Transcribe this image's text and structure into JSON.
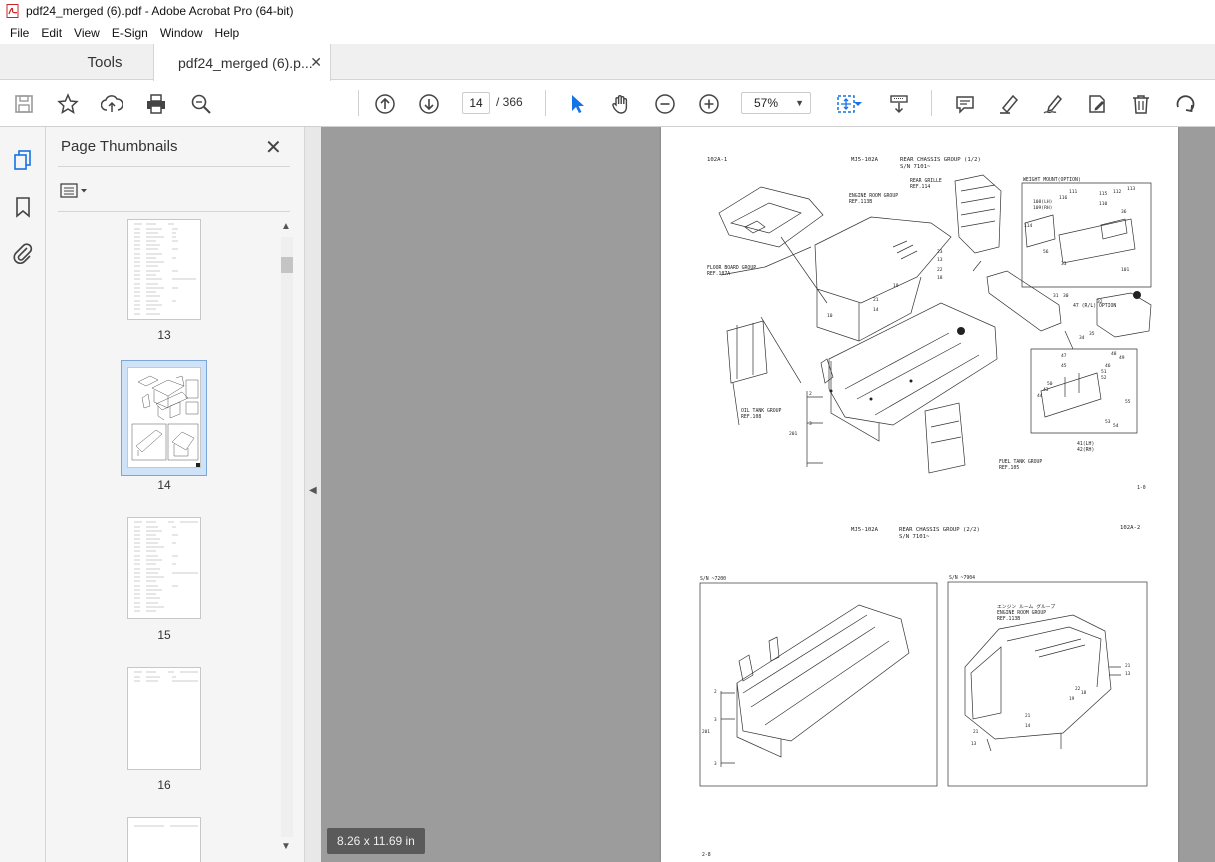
{
  "window": {
    "title": "pdf24_merged (6).pdf - Adobe Acrobat Pro (64-bit)"
  },
  "menu": [
    "File",
    "Edit",
    "View",
    "E-Sign",
    "Window",
    "Help"
  ],
  "tabs": {
    "tools": "Tools",
    "document": "pdf24_merged (6).p...",
    "close_glyph": "✕"
  },
  "toolbar": {
    "current_page": "14",
    "total_pages": "/ 366",
    "zoom": "57%",
    "icons": [
      "save-icon",
      "bookmark-star-icon",
      "upload-icon",
      "print-icon",
      "zoom-search-icon",
      "page-up-icon",
      "page-down-icon",
      "select-cursor-icon",
      "hand-icon",
      "zoom-out-icon",
      "zoom-in-icon",
      "fit-page-icon",
      "scroll-mode-icon",
      "comment-icon",
      "highlight-icon",
      "sign-icon",
      "edit-icon",
      "delete-icon",
      "rotate-icon"
    ]
  },
  "side_panel": {
    "title": "Page Thumbnails",
    "close_glyph": "✕",
    "thumbnails": [
      {
        "label": "13",
        "kind": "list"
      },
      {
        "label": "14",
        "kind": "drawing",
        "selected": true
      },
      {
        "label": "15",
        "kind": "list"
      },
      {
        "label": "16",
        "kind": "short-list"
      }
    ]
  },
  "page_size_label": "8.26 x 11.69 in",
  "document_page": {
    "header_left": "102A-1",
    "header_code": "MJ5-102A",
    "header_title": "REAR CHASSIS GROUP (1/2)",
    "header_sn": "S/N 7101~",
    "labels": {
      "engine_room": "ENGINE ROOM GROUP",
      "engine_room_ref": "REF.113B",
      "rear_grille": "REAR GRILLE",
      "rear_grille_ref": "REF.114",
      "weight_mount": "WEIGHT MOUNT(OPTION)",
      "floor_board": "FLOOR BOARD GROUP",
      "floor_board_ref": "REF.107A",
      "oil_tank": "OIL TANK GROUP",
      "oil_tank_ref": "REF.108",
      "fuel_tank": "FUEL TANK GROUP",
      "fuel_tank_ref": "REF.105",
      "option": "47 (R/L) OPTION",
      "part_41": "41(LH)",
      "part_42": "42(RH)",
      "corner_mark": "1-0"
    },
    "section2_code": "MJ5-102A",
    "section2_title": "REAR CHASSIS GROUP (2/2)",
    "section2_sn": "S/N 7101~",
    "section2_right": "102A-2",
    "box1_label": "S/N ~7200",
    "box2_label": "S/N ~7904",
    "box2_jp": "エンジン ルーム グループ",
    "box2_title": "ENGINE ROOM GROUP",
    "box2_ref": "REF.113B",
    "footer": "2-8",
    "callouts": [
      "111",
      "115",
      "112",
      "113",
      "108(LH)",
      "109(RH)",
      "116",
      "110",
      "114",
      "101",
      "23",
      "13",
      "22",
      "18",
      "19",
      "21",
      "14",
      "10",
      "2",
      "3",
      "201",
      "31",
      "30",
      "32",
      "33",
      "34",
      "35",
      "36",
      "47",
      "45",
      "46",
      "48",
      "49",
      "50",
      "43",
      "44",
      "51",
      "52",
      "53",
      "54",
      "55",
      "56"
    ]
  }
}
